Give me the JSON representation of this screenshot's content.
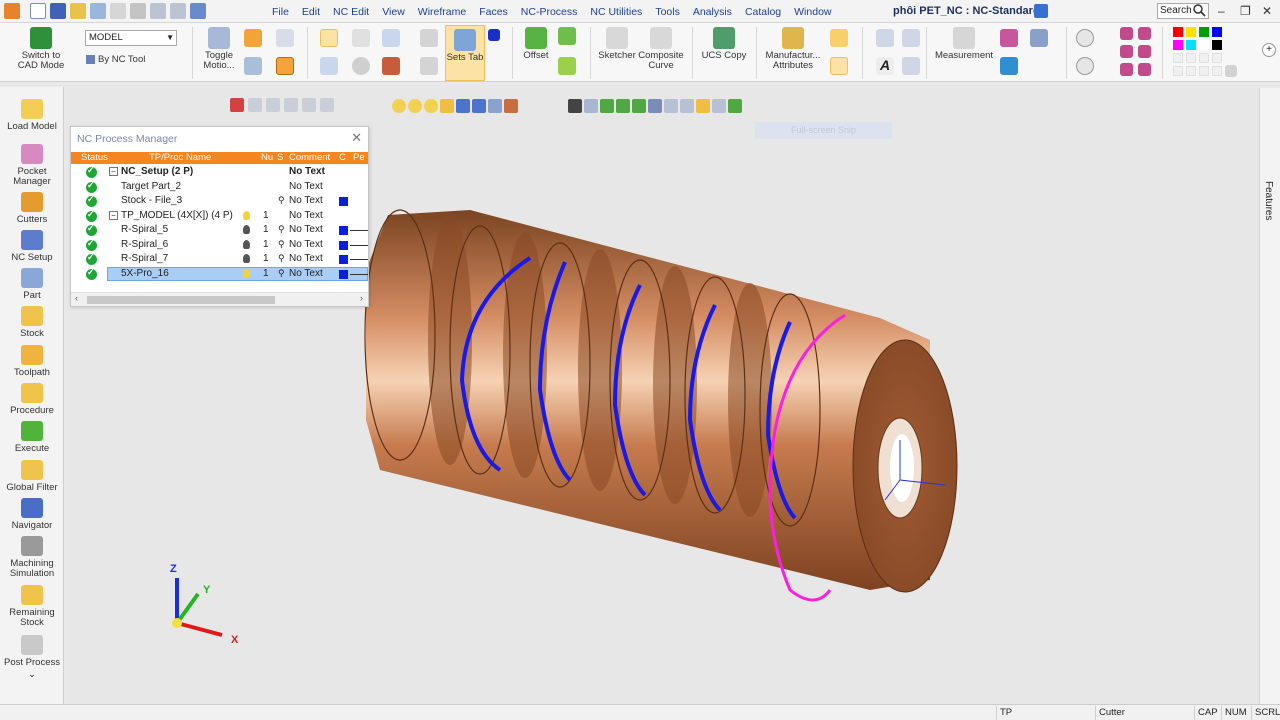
{
  "menubar": {
    "menus": [
      "File",
      "Edit",
      "NC Edit",
      "View",
      "Wireframe",
      "Faces",
      "NC-Process",
      "NC Utilities",
      "Tools",
      "Analysis",
      "Catalog",
      "Window"
    ],
    "title": "phôi PET_NC : NC-Standard",
    "search_placeholder": "Search"
  },
  "ribbon": {
    "switch_cad": "Switch to CAD Mode",
    "model_select": "MODEL",
    "by_nc_tool": "By NC Tool",
    "toggle_motion": "Toggle Motio...",
    "sets_tab": "Sets Tab",
    "offset": "Offset",
    "sketcher": "Sketcher",
    "composite_curve": "Composite Curve",
    "ucs_copy": "UCS Copy",
    "manufacturing_attributes": "Manufactur... Attributes",
    "measurement": "Measurement",
    "palette_colors": [
      "#ff0000",
      "#ffe100",
      "#00a000",
      "#0000ff",
      "#ff00ff",
      "#00e0ff",
      "#ffffff",
      "#000000"
    ]
  },
  "sidebar": {
    "items": [
      "Load Model",
      "Pocket Manager",
      "Cutters",
      "NC Setup",
      "Part",
      "Stock",
      "Toolpath",
      "Procedure",
      "Execute",
      "Global Filter",
      "Navigator",
      "Machining Simulation",
      "Remaining Stock",
      "Post Process"
    ]
  },
  "viewport": {
    "fullscreen_strip": "Full-screen Snip",
    "triad": {
      "x": "X",
      "y": "Y",
      "z": "Z"
    }
  },
  "nc_process_manager": {
    "title": "NC Process Manager",
    "columns": [
      "Status",
      "TP/Proc Name",
      "Nu",
      "S",
      "Comment",
      "C",
      "Pe"
    ],
    "rows": [
      {
        "name": "NC_Setup (2 P)",
        "num": "",
        "comment": "No Text"
      },
      {
        "name": "Target Part_2",
        "num": "",
        "comment": "No Text"
      },
      {
        "name": "Stock - File_3",
        "num": "",
        "comment": "No Text"
      },
      {
        "name": "TP_MODEL (4X[X]) (4 P)",
        "num": "1",
        "comment": "No Text"
      },
      {
        "name": "R-Spiral_5",
        "num": "1",
        "comment": "No Text"
      },
      {
        "name": "R-Spiral_6",
        "num": "1",
        "comment": "No Text"
      },
      {
        "name": "R-Spiral_7",
        "num": "1",
        "comment": "No Text"
      },
      {
        "name": "5X-Pro_16",
        "num": "1",
        "comment": "No Text"
      }
    ]
  },
  "features_tab": "Features",
  "statusbar": {
    "tp": "TP",
    "cutter": "Cutter",
    "cap": "CAP",
    "num": "NUM",
    "scrl": "SCRL"
  }
}
